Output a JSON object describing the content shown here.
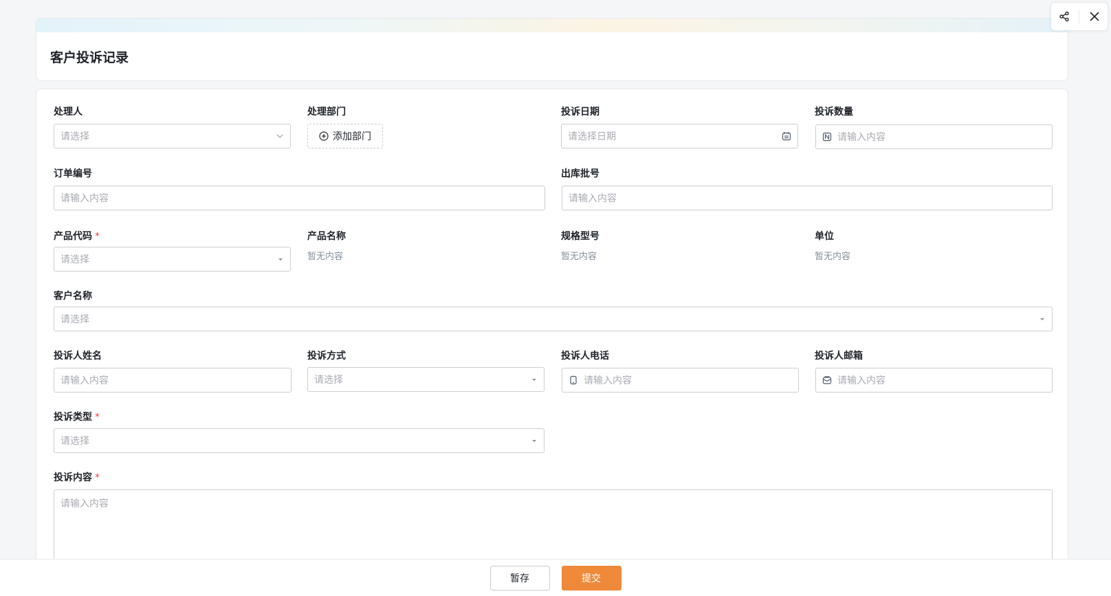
{
  "page": {
    "title": "客户投诉记录"
  },
  "actions": {
    "share_icon": "share-icon",
    "close_icon": "close-icon"
  },
  "form": {
    "handler": {
      "label": "处理人",
      "placeholder": "请选择"
    },
    "department": {
      "label": "处理部门",
      "button": "添加部门"
    },
    "complaint_date": {
      "label": "投诉日期",
      "placeholder": "请选择日期"
    },
    "complaint_qty": {
      "label": "投诉数量",
      "placeholder": "请输入内容"
    },
    "order_no": {
      "label": "订单编号",
      "placeholder": "请输入内容"
    },
    "batch_no": {
      "label": "出库批号",
      "placeholder": "请输入内容"
    },
    "product_code": {
      "label": "产品代码",
      "required": "*",
      "placeholder": "请选择"
    },
    "product_name": {
      "label": "产品名称",
      "value": "暂无内容"
    },
    "spec_model": {
      "label": "规格型号",
      "value": "暂无内容"
    },
    "unit": {
      "label": "单位",
      "value": "暂无内容"
    },
    "customer_name": {
      "label": "客户名称",
      "placeholder": "请选择"
    },
    "complainant_name": {
      "label": "投诉人姓名",
      "placeholder": "请输入内容"
    },
    "complaint_method": {
      "label": "投诉方式",
      "placeholder": "请选择"
    },
    "complainant_phone": {
      "label": "投诉人电话",
      "placeholder": "请输入内容"
    },
    "complainant_email": {
      "label": "投诉人邮箱",
      "placeholder": "请输入内容"
    },
    "complaint_type": {
      "label": "投诉类型",
      "required": "*",
      "placeholder": "请选择"
    },
    "complaint_content": {
      "label": "投诉内容",
      "required": "*",
      "placeholder": "请输入内容"
    }
  },
  "footer": {
    "save_label": "暂存",
    "submit_label": "提交"
  },
  "colors": {
    "primary": "#ef8a3b",
    "required": "#f53f3f",
    "border": "#c9cdd4",
    "placeholder": "#a8abb2"
  }
}
